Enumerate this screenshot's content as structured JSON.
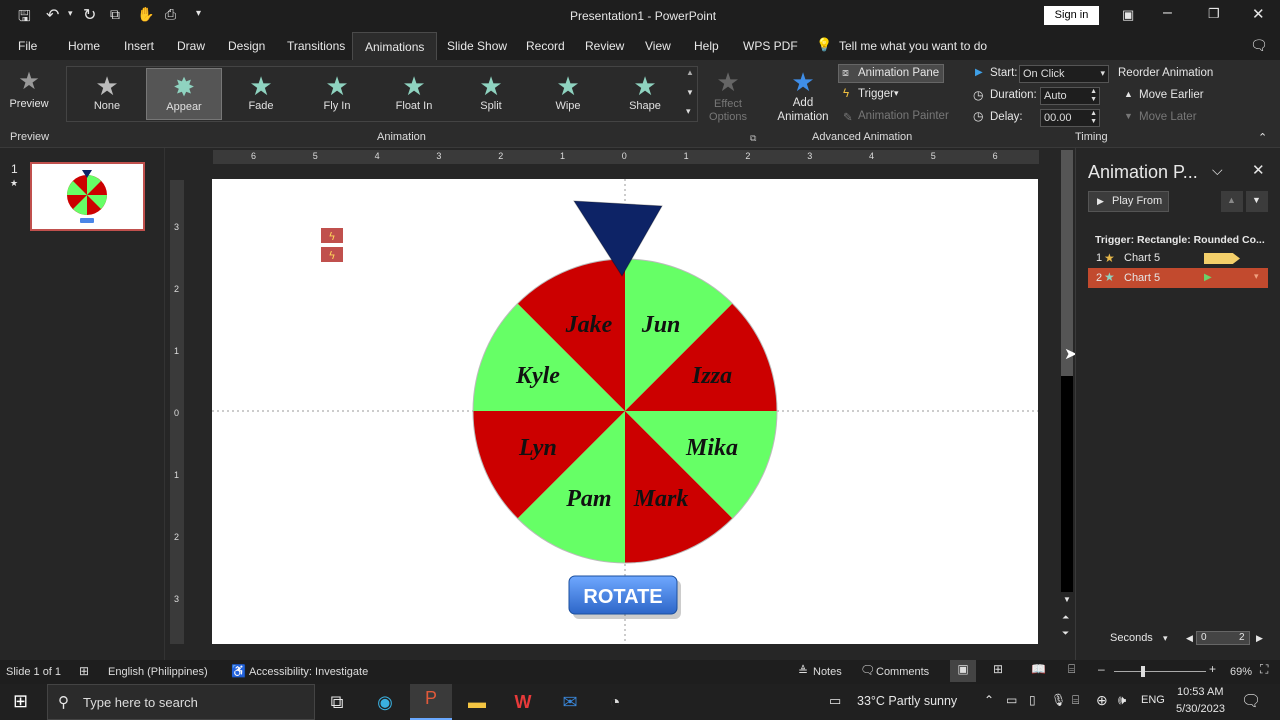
{
  "titlebar": {
    "title": "Presentation1  -  PowerPoint",
    "sign_in": "Sign in"
  },
  "tabs": [
    "File",
    "Home",
    "Insert",
    "Draw",
    "Design",
    "Transitions",
    "Animations",
    "Slide Show",
    "Record",
    "Review",
    "View",
    "Help",
    "WPS PDF"
  ],
  "tell_me": "Tell me what you want to do",
  "ribbon": {
    "preview_label": "Preview",
    "preview_group": "Preview",
    "animations": [
      "None",
      "Appear",
      "Fade",
      "Fly In",
      "Float In",
      "Split",
      "Wipe",
      "Shape"
    ],
    "effect_options": "Effect Options",
    "animation_group": "Animation",
    "add_animation": "Add Animation",
    "animation_pane": "Animation Pane",
    "trigger": "Trigger",
    "animation_painter": "Animation Painter",
    "advanced_group": "Advanced Animation",
    "start_label": "Start:",
    "start_value": "On Click",
    "duration_label": "Duration:",
    "duration_value": "Auto",
    "delay_label": "Delay:",
    "delay_value": "00.00",
    "timing_group": "Timing",
    "reorder": "Reorder Animation",
    "move_earlier": "Move Earlier",
    "move_later": "Move Later"
  },
  "thumbnail_number": "1",
  "ruler_h": [
    "6",
    "5",
    "4",
    "3",
    "2",
    "1",
    "0",
    "1",
    "2",
    "3",
    "4",
    "5",
    "6"
  ],
  "ruler_v": [
    "3",
    "2",
    "1",
    "0",
    "1",
    "2",
    "3"
  ],
  "wheel": {
    "names": [
      "Jun",
      "Izza",
      "Mika",
      "Mark",
      "Pam",
      "Lyn",
      "Kyle",
      "Jake"
    ],
    "colors": [
      "#66ff66",
      "#cc0000"
    ],
    "pointer_color": "#0d2366"
  },
  "rotate_button": "ROTATE",
  "animation_pane": {
    "title": "Animation P...",
    "play_from": "Play From",
    "trigger_text": "Trigger: Rectangle: Rounded Co...",
    "items": [
      {
        "num": "1",
        "name": "Chart 5"
      },
      {
        "num": "2",
        "name": "Chart 5"
      }
    ],
    "seconds": "Seconds",
    "timeline": [
      "0",
      "2"
    ]
  },
  "status": {
    "slide": "Slide 1 of 1",
    "language": "English (Philippines)",
    "accessibility": "Accessibility: Investigate",
    "notes": "Notes",
    "comments": "Comments",
    "zoom": "69%"
  },
  "taskbar": {
    "search_placeholder": "Type here to search",
    "weather": "33°C  Partly sunny",
    "lang": "ENG",
    "time": "10:53 AM",
    "date": "5/30/2023"
  }
}
